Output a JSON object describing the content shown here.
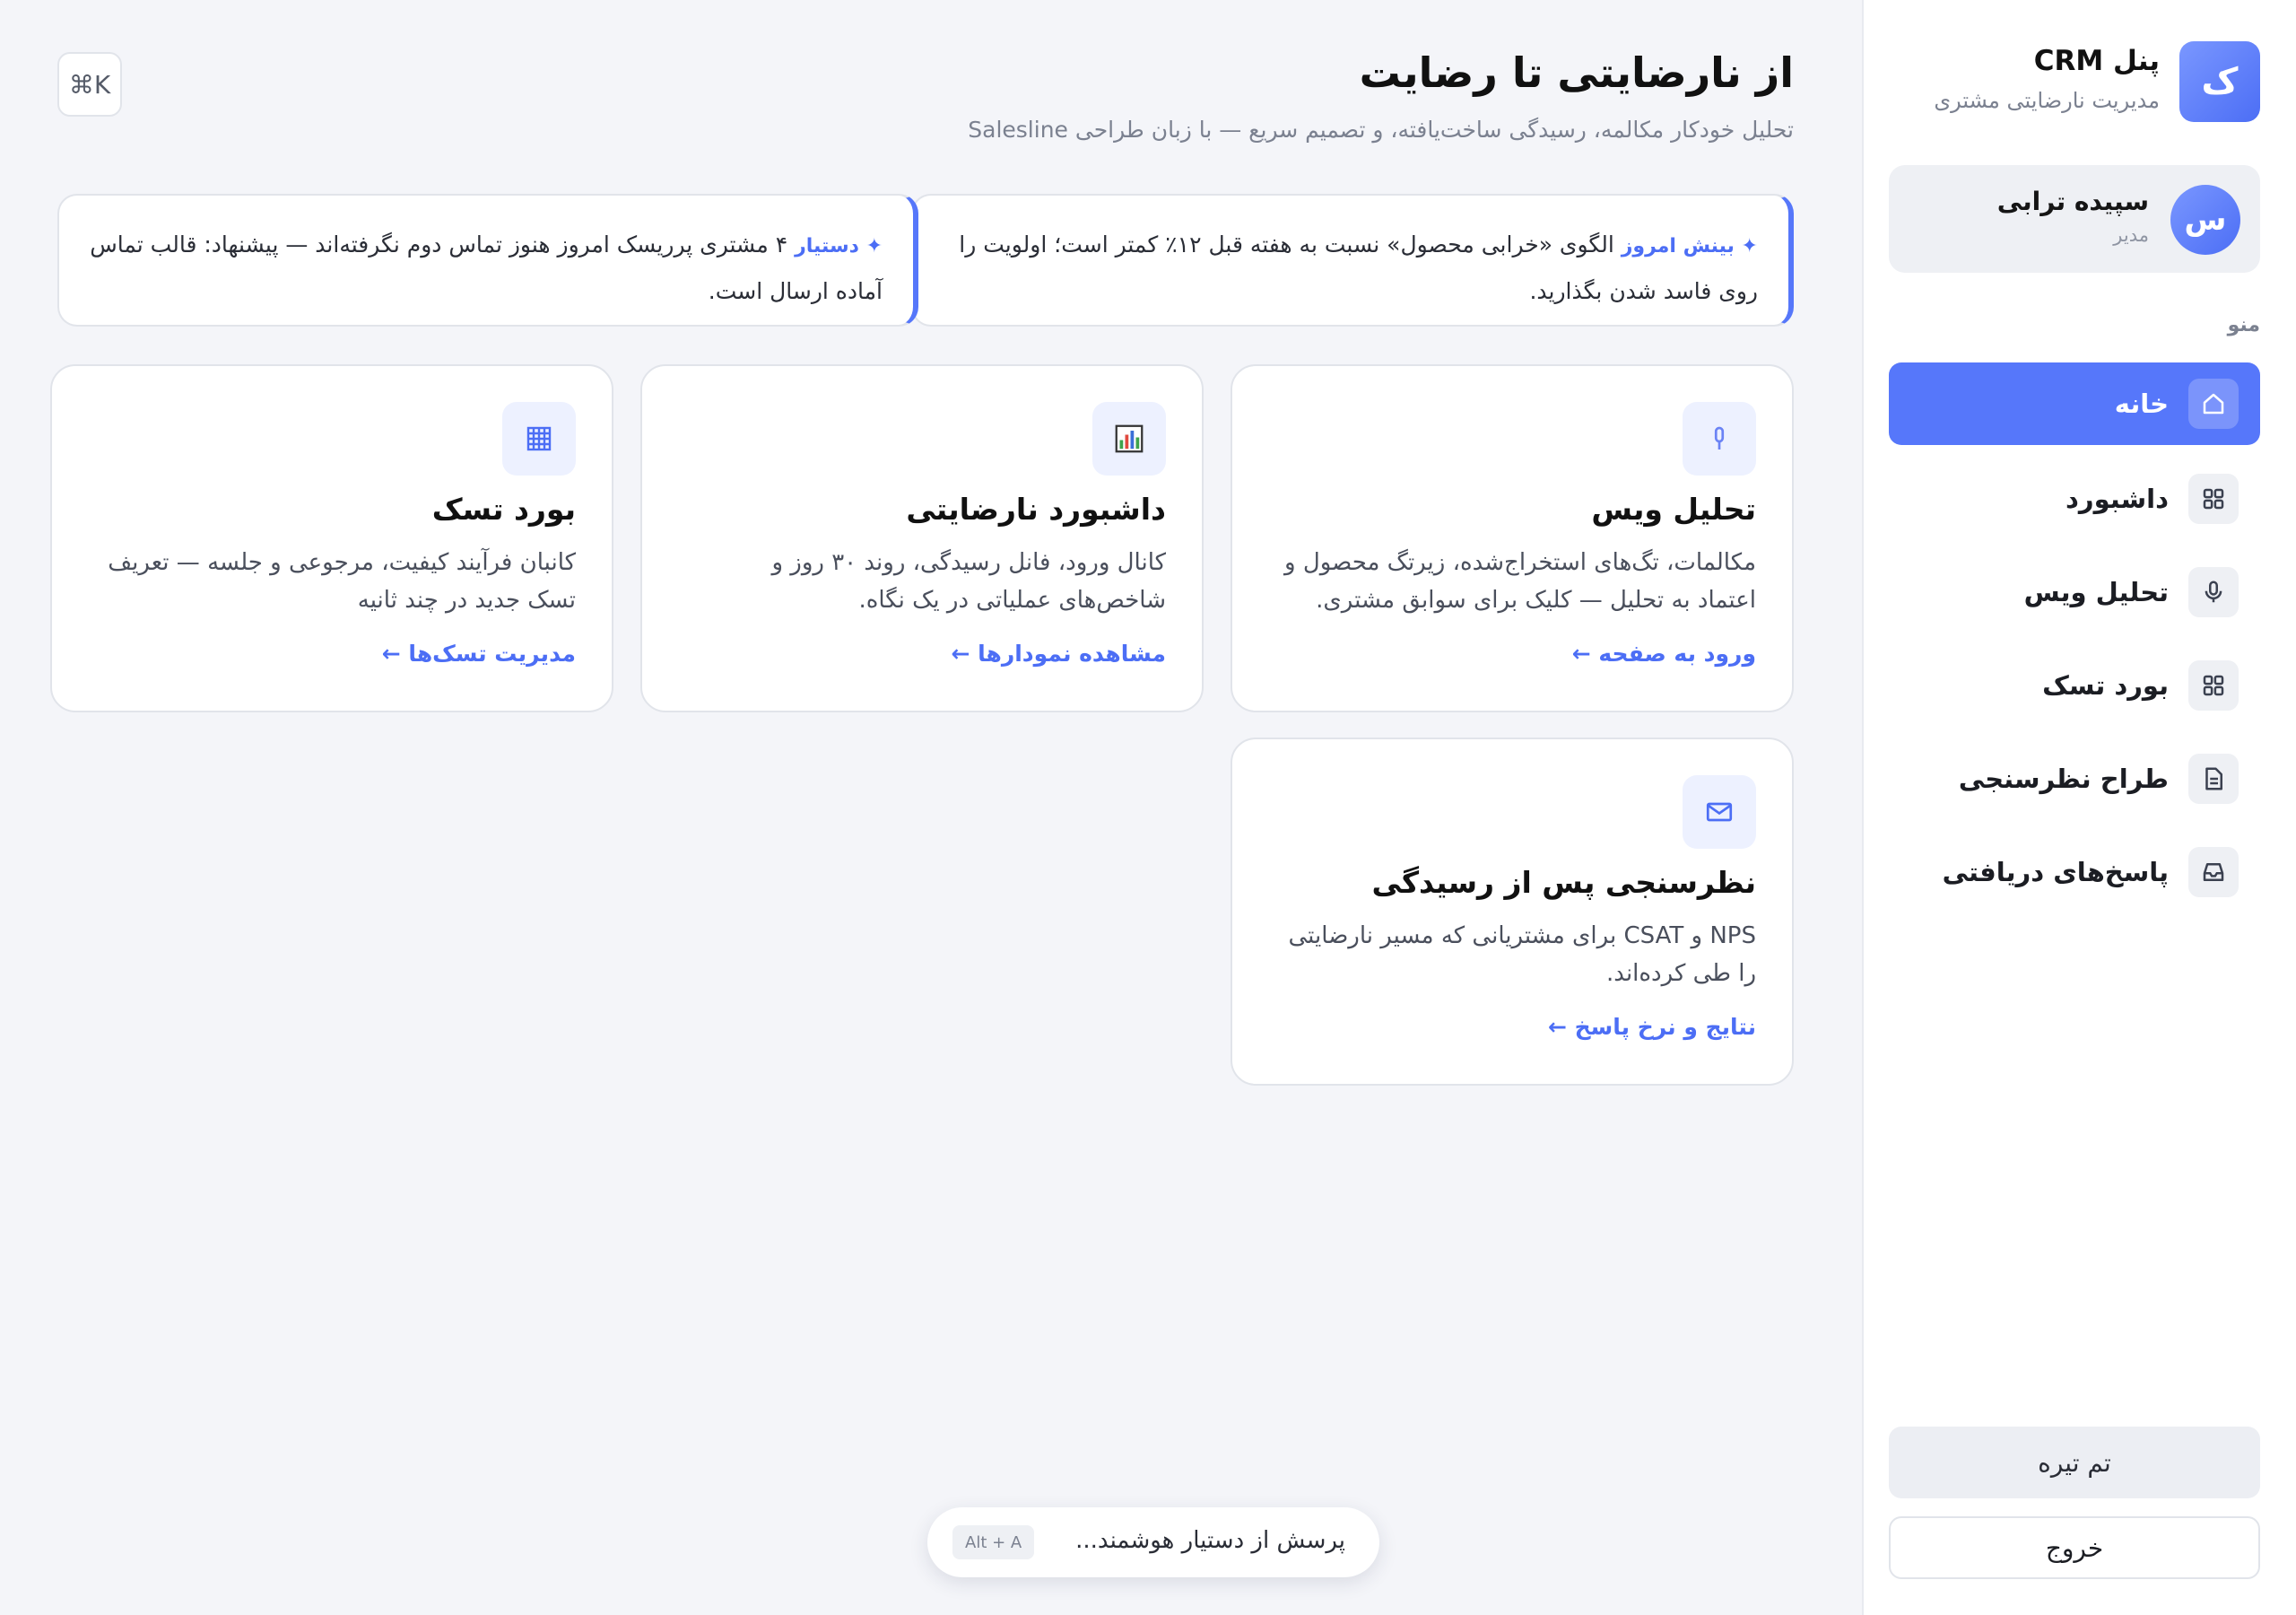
{
  "brand": {
    "logo_letter": "ک",
    "title": "پنل CRM",
    "subtitle": "مدیریت نارضایتی مشتری"
  },
  "user": {
    "avatar_letter": "س",
    "name": "سپیده ترابی",
    "role": "مدیر"
  },
  "sidebar": {
    "menu_label": "منو",
    "items": [
      {
        "label": "خانه",
        "icon": "home-icon",
        "active": true
      },
      {
        "label": "داشبورد",
        "icon": "grid-icon",
        "active": false
      },
      {
        "label": "تحلیل ویس",
        "icon": "microphone-icon",
        "active": false
      },
      {
        "label": "بورد تسک",
        "icon": "grid-icon",
        "active": false
      },
      {
        "label": "طراح نظرسنجی",
        "icon": "document-icon",
        "active": false
      },
      {
        "label": "پاسخ‌های دریافتی",
        "icon": "inbox-icon",
        "active": false
      }
    ],
    "theme_button": "تم تیره",
    "logout_button": "خروج"
  },
  "header": {
    "title": "از نارضایتی تا رضایت",
    "subtitle": "تحلیل خودکار مکالمه، رسیدگی ساخت‌یافته، و تصمیم سریع — با زبان طراحی Salesline",
    "shortcut": "⌘K"
  },
  "insights": [
    {
      "tag": "✦ بینش امروز",
      "text": " الگوی «خرابی محصول» نسبت به هفته قبل ۱۲٪ کمتر است؛ اولویت را روی فاسد شدن بگذارید."
    },
    {
      "tag": "✦ دستیار",
      "text": " ۴ مشتری پرریسک امروز هنوز تماس دوم نگرفته‌اند — پیشنهاد: قالب تماس آماده ارسال است."
    }
  ],
  "cards": [
    {
      "title": "تحلیل ویس",
      "desc": "مکالمات، تگ‌های استخراج‌شده، زیرتگ محصول و اعتماد به تحلیل — کلیک برای سوابق مشتری.",
      "link": "ورود به صفحه ←",
      "icon": "microphone-icon"
    },
    {
      "title": "داشبورد نارضایتی",
      "desc": "کانال ورود، فانل رسیدگی، روند ۳۰ روز و شاخص‌های عملیاتی در یک نگاه.",
      "link": "مشاهده نمودارها ←",
      "icon": "bar-chart-icon"
    },
    {
      "title": "بورد تسک",
      "desc": "کانبان فرآیند کیفیت، مرجوعی و جلسه — تعریف تسک جدید در چند ثانیه",
      "link": "مدیریت تسک‌ها ←",
      "icon": "table-grid-icon"
    },
    {
      "title": "نظرسنجی پس از رسیدگی",
      "desc": "NPS و CSAT برای مشتریانی که مسیر نارضایتی را طی کرده‌اند.",
      "link": "نتایج و نرخ پاسخ ←",
      "icon": "mail-icon"
    }
  ],
  "assistant": {
    "placeholder": "پرسش از دستیار هوشمند...",
    "shortcut": "Alt + A"
  },
  "colors": {
    "accent": "#5677fa",
    "background": "#f4f5f9",
    "link": "#4c6ef5"
  }
}
